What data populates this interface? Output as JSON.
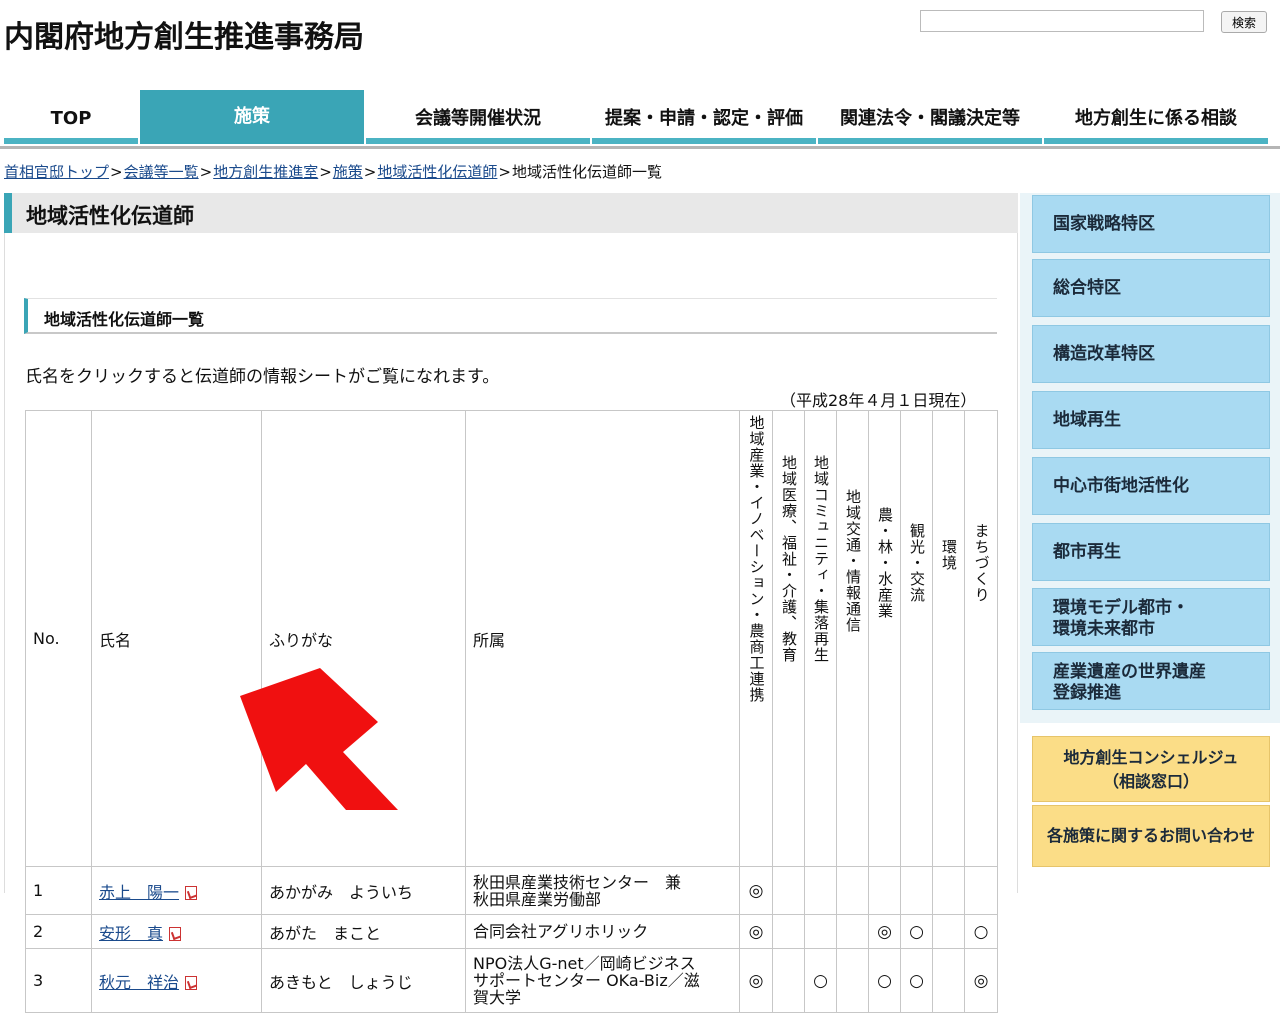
{
  "header": {
    "site_title": "内閣府地方創生推進事務局",
    "search_placeholder": "",
    "search_button": "検索"
  },
  "nav": {
    "tabs": [
      {
        "label": "TOP"
      },
      {
        "label": "施策",
        "active": true
      },
      {
        "label": "会議等開催状況"
      },
      {
        "label": "提案・申請・認定・評価"
      },
      {
        "label": "関連法令・閣議決定等"
      },
      {
        "label": "地方創生に係る相談"
      }
    ]
  },
  "breadcrumb": {
    "items": [
      "首相官邸トップ",
      "会議等一覧",
      "地方創生推進室",
      "施策",
      "地域活性化伝道師"
    ],
    "current": "地域活性化伝道師一覧",
    "separator": ">"
  },
  "main": {
    "page_title": "地域活性化伝道師",
    "section_title": "地域活性化伝道師一覧",
    "intro": "氏名をクリックすると伝道師の情報シートがご覧になれます。",
    "as_of": "（平成28年４月１日現在）"
  },
  "table": {
    "headers": {
      "no": "No.",
      "name": "氏名",
      "furigana": "ふりがな",
      "affiliation": "所属",
      "fields": [
        "地域産業・イノベーション・農商工連携",
        "地域医療、福祉・介護、教育",
        "地域コミュニティ・集落再生",
        "地域交通・情報通信",
        "農・林・水産業",
        "観光・交流",
        "環境",
        "まちづくり"
      ]
    },
    "rows": [
      {
        "no": "1",
        "name": "赤上　陽一",
        "furigana": "あかがみ　よういち",
        "affiliation_lines": [
          "秋田県産業技術センター　兼",
          "秋田県産業労働部"
        ],
        "marks": [
          "◎",
          "",
          "",
          "",
          "",
          "",
          "",
          ""
        ]
      },
      {
        "no": "2",
        "name": "安形　真",
        "furigana": "あがた　まこと",
        "affiliation_lines": [
          "合同会社アグリホリック"
        ],
        "marks": [
          "◎",
          "",
          "",
          "",
          "◎",
          "○",
          "",
          "○"
        ]
      },
      {
        "no": "3",
        "name": "秋元　祥治",
        "furigana": "あきもと　しょうじ",
        "affiliation_lines": [
          "NPO法人G-net／岡崎ビジネス",
          "サポートセンター OKa-Biz／滋",
          "賀大学"
        ],
        "marks": [
          "◎",
          "",
          "○",
          "",
          "○",
          "○",
          "",
          "◎"
        ]
      }
    ]
  },
  "sidebar": {
    "blue_items": [
      {
        "lines": [
          "国家戦略特区"
        ]
      },
      {
        "lines": [
          "総合特区"
        ]
      },
      {
        "lines": [
          "構造改革特区"
        ]
      },
      {
        "lines": [
          "地域再生"
        ]
      },
      {
        "lines": [
          "中心市街地活性化"
        ]
      },
      {
        "lines": [
          "都市再生"
        ]
      },
      {
        "lines": [
          "環境モデル都市・",
          "環境未来都市"
        ]
      },
      {
        "lines": [
          "産業遺産の世界遺産",
          "登録推進"
        ]
      }
    ],
    "yellow_items": [
      {
        "lines": [
          "地方創生コンシェルジュ",
          "（相談窓口）"
        ]
      },
      {
        "lines": [
          "各施策に関するお問い合わせ"
        ]
      }
    ]
  },
  "colors": {
    "accent_teal": "#3aa5b6",
    "sidebar_blue": "#a9daf2",
    "sidebar_yellow": "#fbdd87",
    "arrow_red": "#f01010",
    "link": "#1a4a8c"
  }
}
